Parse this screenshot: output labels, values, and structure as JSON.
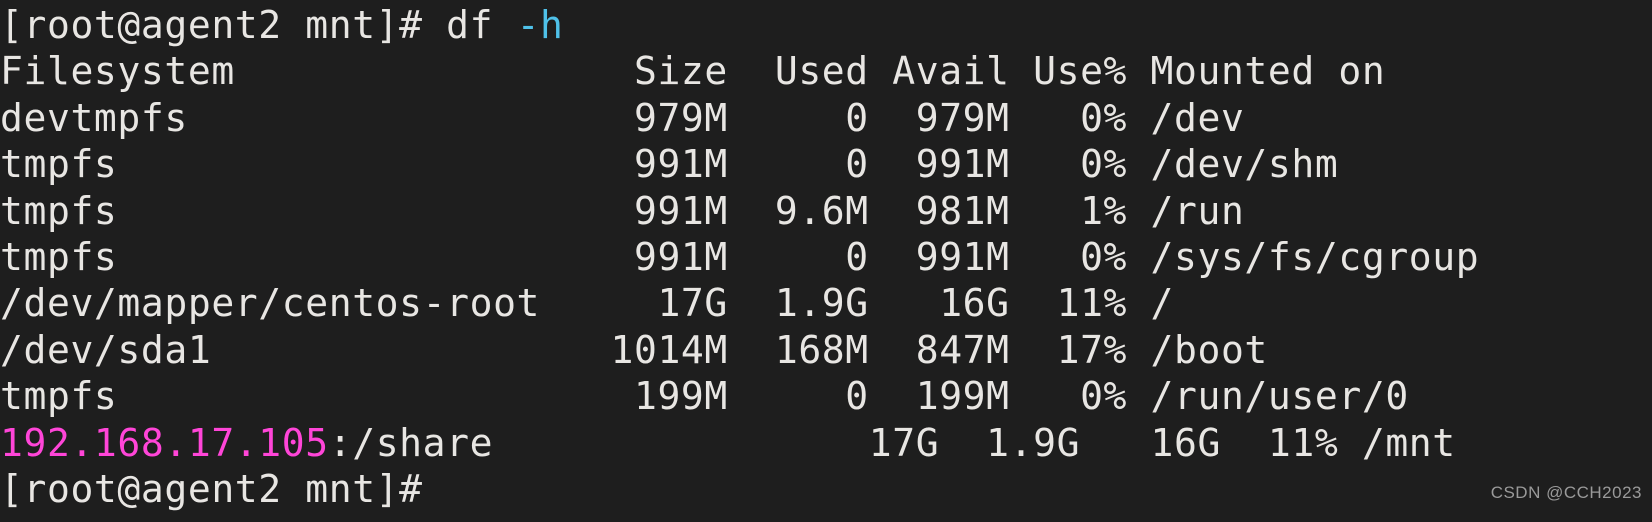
{
  "terminal": {
    "background_color": "#1e1e1e",
    "foreground_color": "#e8e6e3",
    "cyan_color": "#4fc1e9",
    "magenta_color": "#ff45d8",
    "prompt": "[root@agent2 mnt]#",
    "command_name": "df",
    "command_flag": "-h",
    "lines": {
      "prompt_line_prefix": "[root@agent2 mnt]# df ",
      "prompt_line_flag": "-h",
      "header": "Filesystem                 Size  Used Avail Use% Mounted on",
      "row1": "devtmpfs                   979M     0  979M   0% /dev",
      "row2": "tmpfs                      991M     0  991M   0% /dev/shm",
      "row3": "tmpfs                      991M  9.6M  981M   1% /run",
      "row4": "tmpfs                      991M     0  991M   0% /sys/fs/cgroup",
      "row5": "/dev/mapper/centos-root     17G  1.9G   16G  11% /",
      "row6": "/dev/sda1                 1014M  168M  847M  17% /boot",
      "row7": "tmpfs                      199M     0  199M   0% /run/user/0",
      "row8_host": "192.168.17.105",
      "row8_rest": ":/share                17G  1.9G   16G  11% /mnt",
      "last_prompt": "[root@agent2 mnt]#"
    }
  },
  "table": {
    "columns": [
      "Filesystem",
      "Size",
      "Used",
      "Avail",
      "Use%",
      "Mounted on"
    ],
    "rows": [
      {
        "filesystem": "devtmpfs",
        "size": "979M",
        "used": "0",
        "avail": "979M",
        "use_pct": "0%",
        "mounted_on": "/dev"
      },
      {
        "filesystem": "tmpfs",
        "size": "991M",
        "used": "0",
        "avail": "991M",
        "use_pct": "0%",
        "mounted_on": "/dev/shm"
      },
      {
        "filesystem": "tmpfs",
        "size": "991M",
        "used": "9.6M",
        "avail": "981M",
        "use_pct": "1%",
        "mounted_on": "/run"
      },
      {
        "filesystem": "tmpfs",
        "size": "991M",
        "used": "0",
        "avail": "991M",
        "use_pct": "0%",
        "mounted_on": "/sys/fs/cgroup"
      },
      {
        "filesystem": "/dev/mapper/centos-root",
        "size": "17G",
        "used": "1.9G",
        "avail": "16G",
        "use_pct": "11%",
        "mounted_on": "/"
      },
      {
        "filesystem": "/dev/sda1",
        "size": "1014M",
        "used": "168M",
        "avail": "847M",
        "use_pct": "17%",
        "mounted_on": "/boot"
      },
      {
        "filesystem": "tmpfs",
        "size": "199M",
        "used": "0",
        "avail": "199M",
        "use_pct": "0%",
        "mounted_on": "/run/user/0"
      },
      {
        "filesystem": "192.168.17.105:/share",
        "size": "17G",
        "used": "1.9G",
        "avail": "16G",
        "use_pct": "11%",
        "mounted_on": "/mnt"
      }
    ]
  },
  "watermark": {
    "text": "CSDN @CCH2023"
  }
}
